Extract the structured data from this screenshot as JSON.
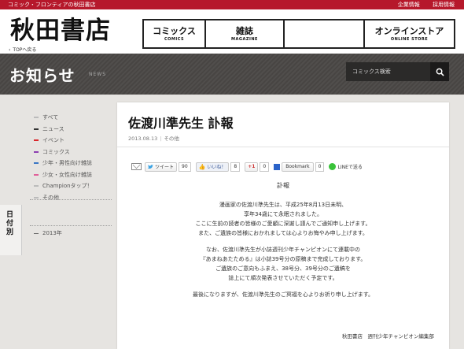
{
  "topbar": {
    "tagline": "コミック・フロンティアの秋田書店",
    "links": [
      "企業情報",
      "採用情報"
    ]
  },
  "header": {
    "logo": "秋田書店",
    "top_link": "TOPへ戻る",
    "nav": [
      {
        "jp": "コミックス",
        "en": "COMICS"
      },
      {
        "jp": "雑誌",
        "en": "MAGAZINE"
      },
      {
        "jp": "",
        "en": ""
      },
      {
        "jp": "オンラインストア",
        "en": "ONLINE STORE"
      }
    ]
  },
  "band": {
    "title": "お知らせ",
    "subtitle": "NEWS",
    "search_placeholder": "コミックス検索"
  },
  "sidebar": {
    "categories": [
      {
        "label": "すべて",
        "color": "#bbbbbb"
      },
      {
        "label": "ニュース",
        "color": "#333333"
      },
      {
        "label": "イベント",
        "color": "#d9262b"
      },
      {
        "label": "コミックス",
        "color": "#8c3fb0"
      },
      {
        "label": "少年・男性向け雑誌",
        "color": "#3a76c4"
      },
      {
        "label": "少女・女性向け雑誌",
        "color": "#e0609a"
      },
      {
        "label": "Championタップ！",
        "color": "#bbbbbb"
      },
      {
        "label": "その他",
        "color": "#bbbbbb"
      }
    ],
    "date_tab": "日付別",
    "years": [
      "2013年"
    ]
  },
  "article": {
    "title": "佐渡川準先生 訃報",
    "date": "2013.08.13",
    "category": "その他",
    "share": {
      "tweet_label": "ツイート",
      "tweet_count": "90",
      "like_label": "いいね！",
      "like_count": "8",
      "gplus_label": "+1",
      "gplus_count": "0",
      "bookmark_label": "Bookmark",
      "bookmark_count": "0",
      "line_label": "LINEで送る"
    },
    "heading": "訃報",
    "paragraphs": [
      [
        "漫画家の佐渡川準先生は、平成25年8月13日未明、",
        "享年34歳にて永眠されました。",
        "ここに生前の読者の皆様のご愛顧に深謝し謹んでご通知申し上げます。",
        "また、ご遺族の皆様におかれましては心よりお悔やみ申し上げます。"
      ],
      [
        "なお、佐渡川準先生が小誌週刊少年チャンピオンにて連載中の",
        "『あまねあたためる』は小誌39号分の原稿まで完成しております。",
        "ご遺族のご意向もふまえ、38号分、39号分のご遺稿を",
        "誌上にて順次発表させていただく予定です。"
      ],
      [
        "最後になりますが、佐渡川準先生のご冥福を心よりお祈り申し上げます。"
      ]
    ],
    "signature": "秋田書店　週刊少年チャンピオン編集部"
  }
}
